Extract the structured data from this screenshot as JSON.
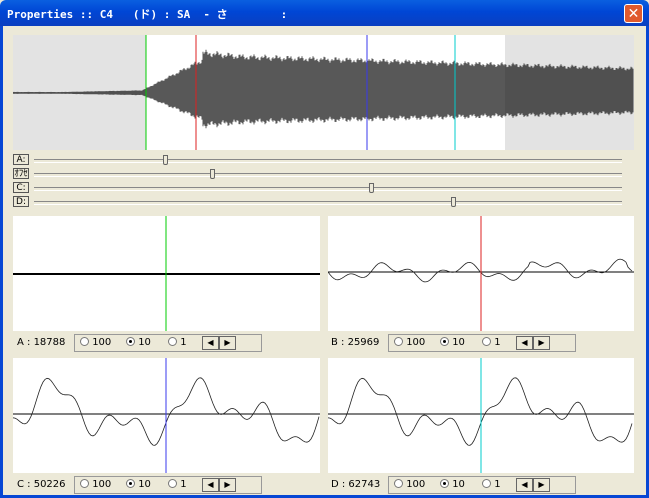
{
  "window": {
    "title": "Properties :: C4   (ド) : SA  - さ        :",
    "close_glyph": "✕"
  },
  "sliders": [
    {
      "label": "A:",
      "value": 0.22
    },
    {
      "label": "ｵﾌｾ",
      "value": 0.3
    },
    {
      "label": "C:",
      "value": 0.57
    },
    {
      "label": "D:",
      "value": 0.71
    }
  ],
  "markers": {
    "green": "#00cc00",
    "red": "#dd2222",
    "blue": "#3a3aee",
    "cyan": "#00cccc"
  },
  "subpanels": [
    {
      "label": "A : 18788",
      "radios": [
        "100",
        "10",
        "1"
      ],
      "selected": "10"
    },
    {
      "label": "B : 25969",
      "radios": [
        "100",
        "10",
        "1"
      ],
      "selected": "10"
    },
    {
      "label": "C : 50226",
      "radios": [
        "100",
        "10",
        "1"
      ],
      "selected": "10"
    },
    {
      "label": "D : 62743",
      "radios": [
        "100",
        "10",
        "1"
      ],
      "selected": "10"
    }
  ],
  "arrows": {
    "left": "◀",
    "right": "▶"
  }
}
